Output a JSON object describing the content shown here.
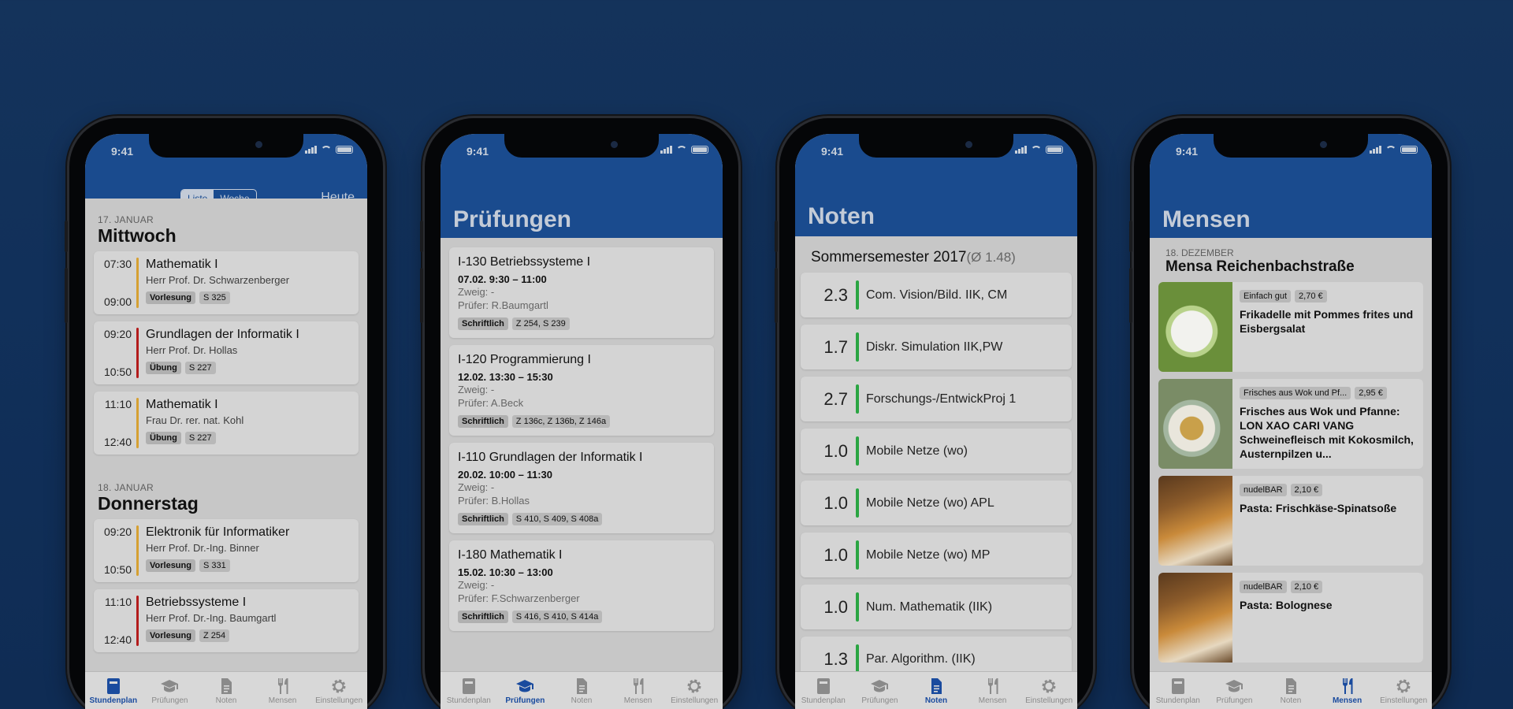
{
  "status_time": "9:41",
  "accent_color": "#1a4b8e",
  "tabbar": [
    "Stundenplan",
    "Prüfungen",
    "Noten",
    "Mensen",
    "Einstellungen"
  ],
  "stundenplan": {
    "segment": {
      "list": "Liste",
      "week": "Woche"
    },
    "today": "Heute",
    "days": [
      {
        "date": "17. JANUAR",
        "weekday": "Mittwoch",
        "lectures": [
          {
            "start": "07:30",
            "end": "09:00",
            "title": "Mathematik I",
            "prof": "Herr Prof. Dr. Schwarzenberger",
            "type": "Vorlesung",
            "room": "S 325",
            "color": "#d6a032"
          },
          {
            "start": "09:20",
            "end": "10:50",
            "title": "Grundlagen der Informatik I",
            "prof": "Herr Prof. Dr. Hollas",
            "type": "Übung",
            "room": "S 227",
            "color": "#b31b1b"
          },
          {
            "start": "11:10",
            "end": "12:40",
            "title": "Mathematik I",
            "prof": "Frau Dr. rer. nat. Kohl",
            "type": "Übung",
            "room": "S 227",
            "color": "#d6a032"
          }
        ]
      },
      {
        "date": "18. JANUAR",
        "weekday": "Donnerstag",
        "lectures": [
          {
            "start": "09:20",
            "end": "10:50",
            "title": "Elektronik für Informatiker",
            "prof": "Herr Prof. Dr.-Ing. Binner",
            "type": "Vorlesung",
            "room": "S 331",
            "color": "#d6a032"
          },
          {
            "start": "11:10",
            "end": "12:40",
            "title": "Betriebssysteme I",
            "prof": "Herr Prof. Dr.-Ing. Baumgartl",
            "type": "Vorlesung",
            "room": "Z 254",
            "color": "#b31b1b"
          }
        ]
      }
    ]
  },
  "pruefungen": {
    "title": "Prüfungen",
    "exams": [
      {
        "title": "I-130  Betriebssysteme I",
        "datetime": "07.02. 9:30 – 11:00",
        "zweig": "Zweig: -",
        "pruefer": "Prüfer: R.Baumgartl",
        "kind": "Schriftlich",
        "rooms": "Z 254, S 239"
      },
      {
        "title": "I-120  Programmierung I",
        "datetime": "12.02. 13:30 – 15:30",
        "zweig": "Zweig: -",
        "pruefer": "Prüfer: A.Beck",
        "kind": "Schriftlich",
        "rooms": "Z 136c, Z 136b, Z 146a"
      },
      {
        "title": "I-110  Grundlagen der Informatik I",
        "datetime": "20.02. 10:00 – 11:30",
        "zweig": "Zweig: -",
        "pruefer": "Prüfer: B.Hollas",
        "kind": "Schriftlich",
        "rooms": "S 410, S 409, S 408a"
      },
      {
        "title": "I-180  Mathematik I",
        "datetime": "15.02. 10:30 – 13:00",
        "zweig": "Zweig: -",
        "pruefer": "Prüfer: F.Schwarzenberger",
        "kind": "Schriftlich",
        "rooms": "S 416, S 410, S 414a"
      }
    ]
  },
  "noten": {
    "title": "Noten",
    "semester": "Sommersemester 2017",
    "average": "(Ø 1.48)",
    "grades": [
      {
        "grade": "2.3",
        "name": "Com. Vision/Bild. IIK, CM"
      },
      {
        "grade": "1.7",
        "name": "Diskr. Simulation IIK,PW"
      },
      {
        "grade": "2.7",
        "name": "Forschungs-/EntwickProj 1"
      },
      {
        "grade": "1.0",
        "name": "Mobile Netze (wo)"
      },
      {
        "grade": "1.0",
        "name": "Mobile Netze (wo)  APL"
      },
      {
        "grade": "1.0",
        "name": "Mobile Netze (wo) MP"
      },
      {
        "grade": "1.0",
        "name": "Num. Mathematik (IIK)"
      },
      {
        "grade": "1.3",
        "name": "Par. Algorithm. (IIK)"
      }
    ]
  },
  "mensen": {
    "title": "Mensen",
    "date": "18. DEZEMBER",
    "name": "Mensa Reichenbachstraße",
    "meals": [
      {
        "line": "Einfach gut",
        "price": "2,70 €",
        "name": "Frikadelle mit Pommes frites und Eisbergsalat",
        "icon": "sausage-fries-photo"
      },
      {
        "line": "Frisches aus Wok und Pf...",
        "price": "2,95 €",
        "name": "Frisches aus Wok und Pfanne: LON XAO CARI VANG Schweinefleisch mit Kokosmilch, Austernpilzen u...",
        "icon": "wok-dish-photo"
      },
      {
        "line": "nudelBAR",
        "price": "2,10 €",
        "name": "Pasta: Frischkäse-Spinatsoße",
        "icon": "pasta-cook-photo"
      },
      {
        "line": "nudelBAR",
        "price": "2,10 €",
        "name": "Pasta: Bolognese",
        "icon": "pasta-cook-photo"
      }
    ]
  }
}
